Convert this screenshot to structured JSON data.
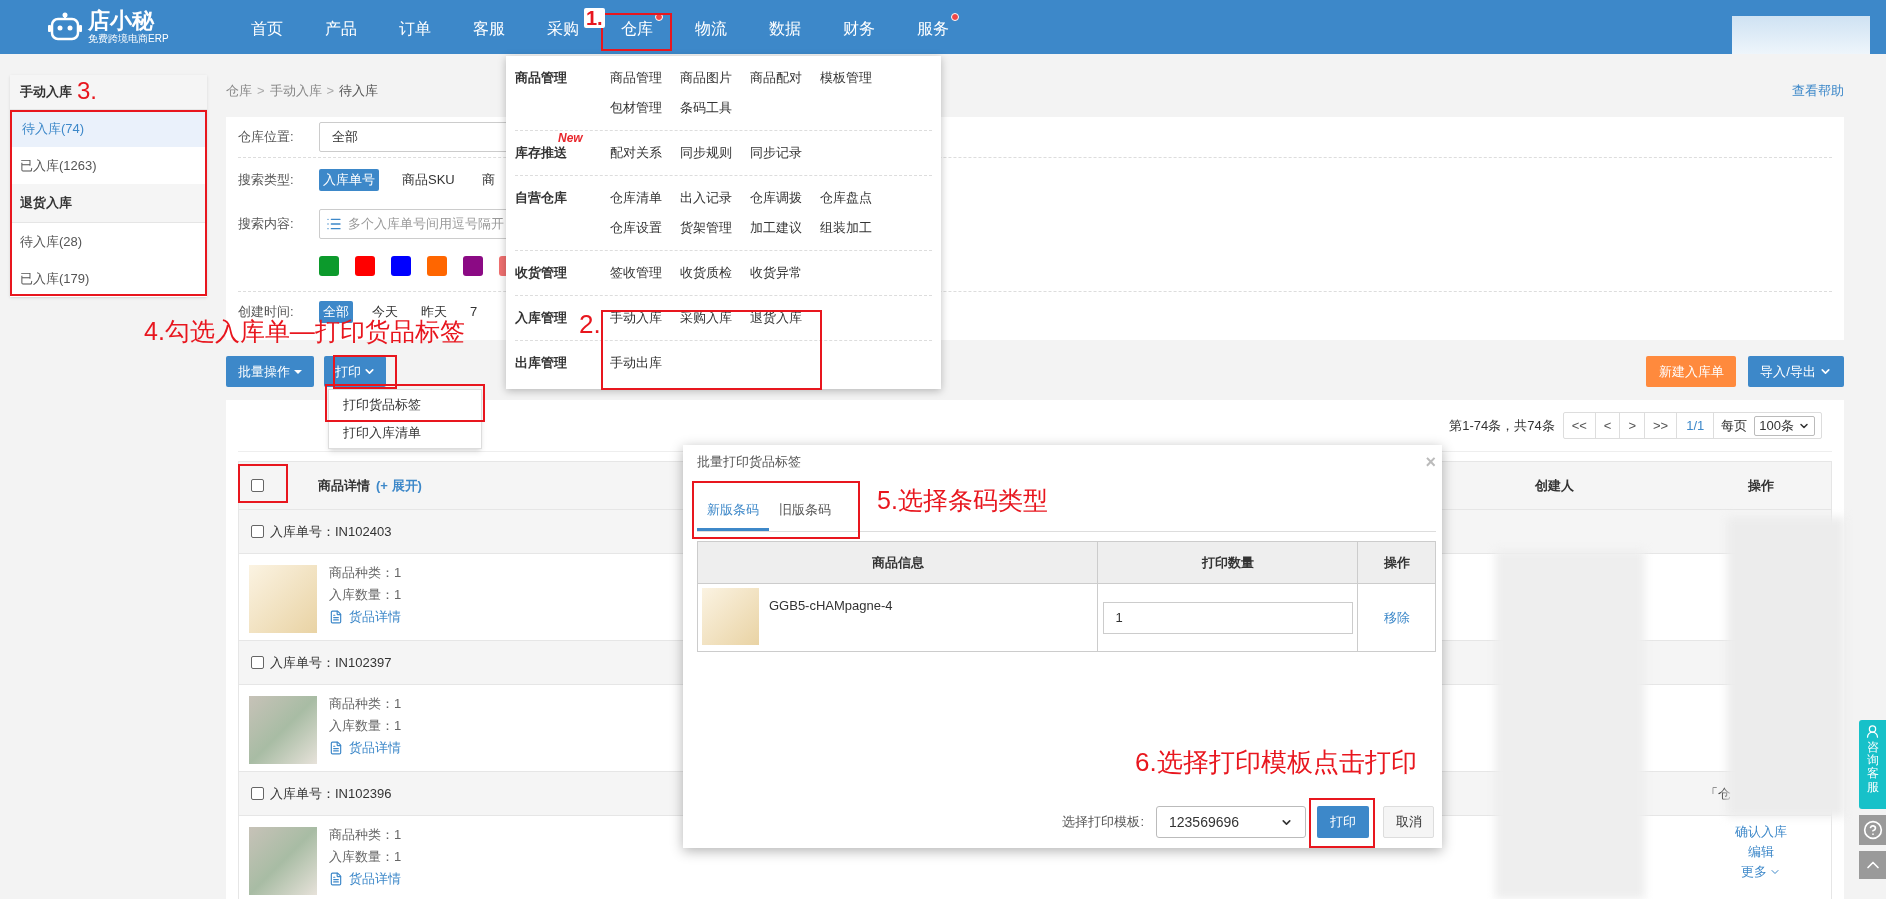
{
  "logo": {
    "name": "店小秘",
    "tagline": "免费跨境电商ERP"
  },
  "nav": [
    {
      "label": "首页",
      "dot": false
    },
    {
      "label": "产品",
      "dot": false
    },
    {
      "label": "订单",
      "dot": false
    },
    {
      "label": "客服",
      "dot": false
    },
    {
      "label": "采购",
      "dot": false
    },
    {
      "label": "仓库",
      "dot": true
    },
    {
      "label": "物流",
      "dot": false
    },
    {
      "label": "数据",
      "dot": false
    },
    {
      "label": "财务",
      "dot": false
    },
    {
      "label": "服务",
      "dot": true
    }
  ],
  "sidebar": [
    {
      "title": "手动入库",
      "items": [
        {
          "label": "待入库(74)",
          "selected": true
        },
        {
          "label": "已入库(1263)",
          "selected": false
        }
      ]
    },
    {
      "title": "退货入库",
      "items": [
        {
          "label": "待入库(28)",
          "selected": false
        },
        {
          "label": "已入库(179)",
          "selected": false
        }
      ]
    }
  ],
  "breadcrumb": {
    "items": [
      "仓库",
      "手动入库",
      "待入库"
    ],
    "separator": ">"
  },
  "help_link": "查看帮助",
  "filters": {
    "warehouse": {
      "label": "仓库位置:",
      "value": "全部"
    },
    "search_type": {
      "label": "搜索类型:",
      "options": [
        {
          "label": "入库单号",
          "selected": true
        },
        {
          "label": "商品SKU",
          "selected": false
        },
        {
          "label": "商",
          "selected": false
        }
      ]
    },
    "search_content": {
      "label": "搜索内容:",
      "placeholder": "多个入库单号间用逗号隔开"
    },
    "tag_colors": [
      {
        "color": "#0c9a2c"
      },
      {
        "color": "#ff0000"
      },
      {
        "color": "#0000ff"
      },
      {
        "color": "#ff6600"
      },
      {
        "color": "#8b0a84"
      },
      {
        "color": "#f07070"
      }
    ],
    "created_time": {
      "label": "创建时间:",
      "options": [
        {
          "label": "全部",
          "selected": true
        },
        {
          "label": "今天",
          "selected": false
        },
        {
          "label": "昨天",
          "selected": false
        },
        {
          "label": "7",
          "selected": false
        }
      ]
    }
  },
  "actions": {
    "batch": "批量操作",
    "print": "打印",
    "new": "新建入库单",
    "import_export": "导入/导出"
  },
  "print_menu": [
    "打印货品标签",
    "打印入库清单"
  ],
  "pagination": {
    "summary": "第1-74条，共74条",
    "buttons": [
      "<<",
      "<",
      ">",
      ">>"
    ],
    "page": "1/1",
    "per_page_label": "每页",
    "per_page": "100条"
  },
  "table": {
    "checked": false,
    "details": "商品详情",
    "expand": "(+ 展开)",
    "creator": "创建人",
    "actions": "操作"
  },
  "orders": [
    {
      "number": "入库单号：IN102403",
      "checked": false,
      "kind": "no-image",
      "kinds": "商品种类：1",
      "quantity": "入库数量：1",
      "link": "货品详情"
    },
    {
      "number": "入库单号：IN102397",
      "checked": false,
      "kind": "photo",
      "kinds": "商品种类：1",
      "quantity": "入库数量：1",
      "link": "货品详情"
    },
    {
      "number": "入库单号：IN102396",
      "checked": false,
      "kind": "photo",
      "kinds": "商品种类：1",
      "quantity": "入库数量：1",
      "link": "货品详情",
      "note": "「仓",
      "operations": [
        "确认入库",
        "编辑",
        "更多"
      ]
    }
  ],
  "mega_menu": [
    {
      "title": "商品管理",
      "links": [
        "商品管理",
        "商品图片",
        "商品配对",
        "模板管理",
        "包材管理",
        "条码工具"
      ]
    },
    {
      "title": "库存推送",
      "badge": "New",
      "links": [
        "配对关系",
        "同步规则",
        "同步记录"
      ]
    },
    {
      "title": "自营仓库",
      "links": [
        "仓库清单",
        "出入记录",
        "仓库调拨",
        "仓库盘点",
        "仓库设置",
        "货架管理",
        "加工建议",
        "组装加工"
      ]
    },
    {
      "title": "收货管理",
      "links": [
        "签收管理",
        "收货质检",
        "收货异常"
      ]
    },
    {
      "title": "入库管理",
      "links": [
        "手动入库",
        "采购入库",
        "退货入库"
      ]
    },
    {
      "title": "出库管理",
      "links": [
        "手动出库"
      ]
    }
  ],
  "modal": {
    "title": "批量打印货品标签",
    "close": "×",
    "tabs": [
      {
        "label": "新版条码",
        "selected": true
      },
      {
        "label": "旧版条码",
        "selected": false
      }
    ],
    "columns": [
      "商品信息",
      "打印数量",
      "操作"
    ],
    "rows": [
      {
        "kind": "no-image",
        "sku": "GGB5-cHAMpagne-4",
        "quantity": "1",
        "action": "移除"
      }
    ],
    "template_label": "选择打印模板:",
    "template": "123569696",
    "print": "打印",
    "cancel": "取消"
  },
  "annotations": [
    "1.",
    "2.",
    "3.",
    "4.勾选入库单—打印货品标签",
    "5.选择条码类型",
    "6.选择打印模板点击打印"
  ],
  "side_widget": {
    "service": "咨询客服"
  }
}
